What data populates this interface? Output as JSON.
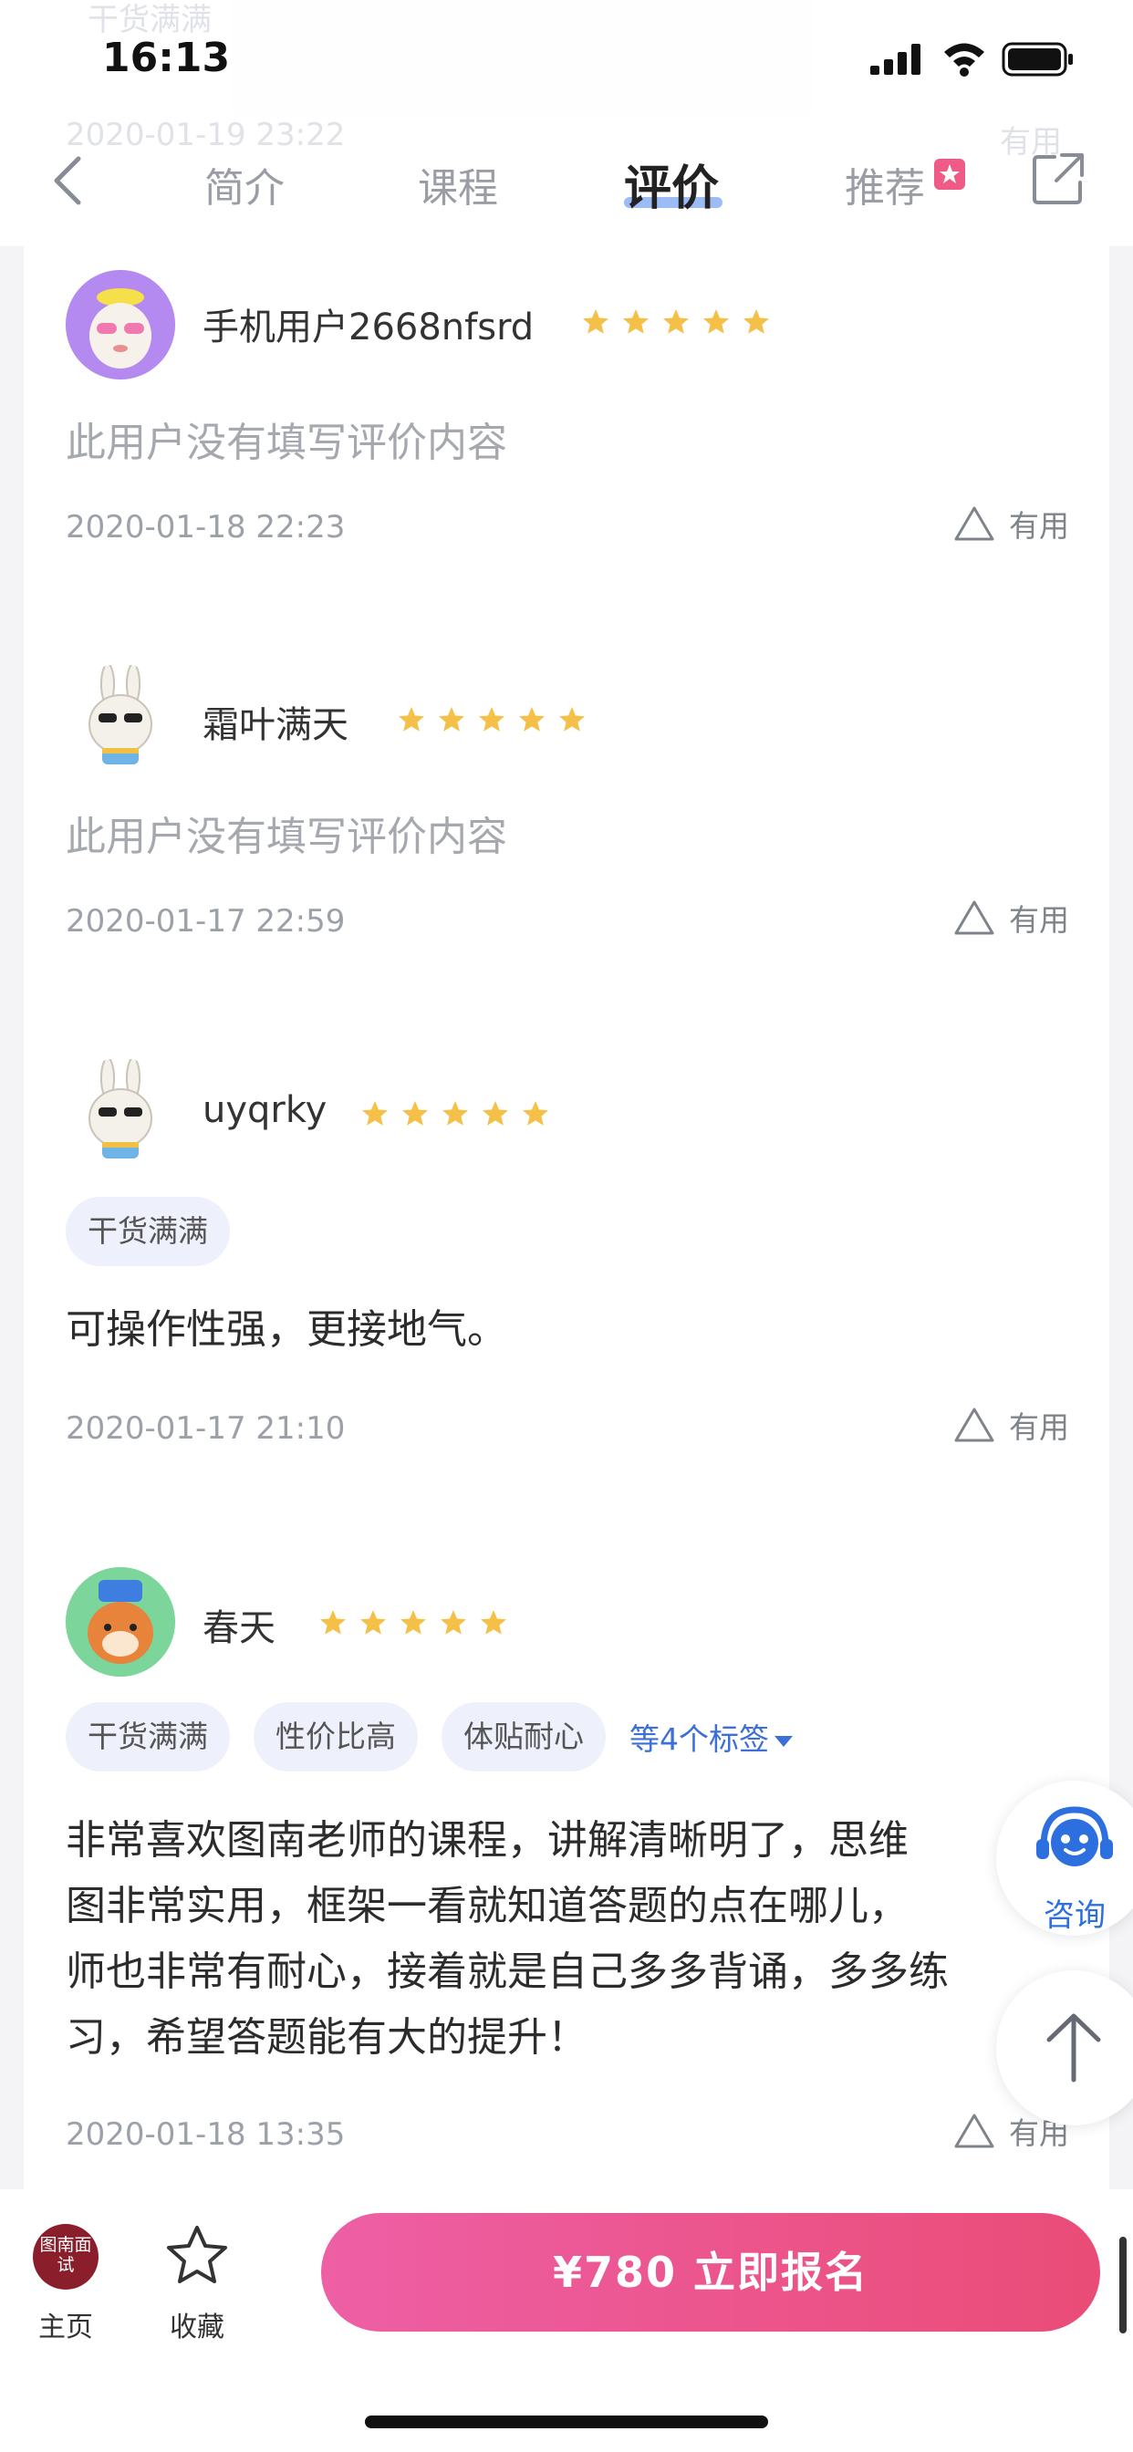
{
  "status_bar": {
    "time": "16:13"
  },
  "header": {
    "ghost_tag": "干货满满",
    "ghost_date": "2020-01-19 23:22",
    "ghost_useful": "有用",
    "tabs": [
      {
        "label": "简介",
        "active": false
      },
      {
        "label": "课程",
        "active": false
      },
      {
        "label": "评价",
        "active": true
      },
      {
        "label": "推荐",
        "active": false,
        "badge": true
      }
    ]
  },
  "reviews": [
    {
      "username": "手机用户2668nfsrd",
      "rating": 5,
      "tags": [],
      "content": "此用户没有填写评价内容",
      "date": "2020-01-18 22:23",
      "useful_label": "有用"
    },
    {
      "username": "霜叶满天",
      "rating": 5,
      "tags": [],
      "content": "此用户没有填写评价内容",
      "date": "2020-01-17 22:59",
      "useful_label": "有用"
    },
    {
      "username": "uyqrky",
      "rating": 5,
      "tags": [
        "干货满满"
      ],
      "content": "可操作性强，更接地气。",
      "date": "2020-01-17 21:10",
      "useful_label": "有用"
    },
    {
      "username": "春天",
      "rating": 5,
      "tags": [
        "干货满满",
        "性价比高",
        "体贴耐心"
      ],
      "more_tags": "等4个标签",
      "content_lines": [
        "非常喜欢图南老师的课程，讲解清晰明了，思维",
        "图非常实用，框架一看就知道答题的点在哪儿，",
        "师也非常有耐心，接着就是自己多多背诵，多多练",
        "习，希望答题能有大的提升！"
      ],
      "date": "2020-01-18 13:35",
      "useful_label": "有用"
    }
  ],
  "floating": {
    "consult_label": "咨询"
  },
  "bottom_bar": {
    "logo_text": "图南面试",
    "home_label": "主页",
    "favorite_label": "收藏",
    "enroll_label": "¥780  立即报名"
  },
  "colors": {
    "accent_blue": "#2e6fe0",
    "star_yellow": "#f5c047",
    "enroll_gradient_start": "#ee5fa5",
    "enroll_gradient_end": "#ea4c77",
    "logo_red": "#8a1e2a"
  }
}
